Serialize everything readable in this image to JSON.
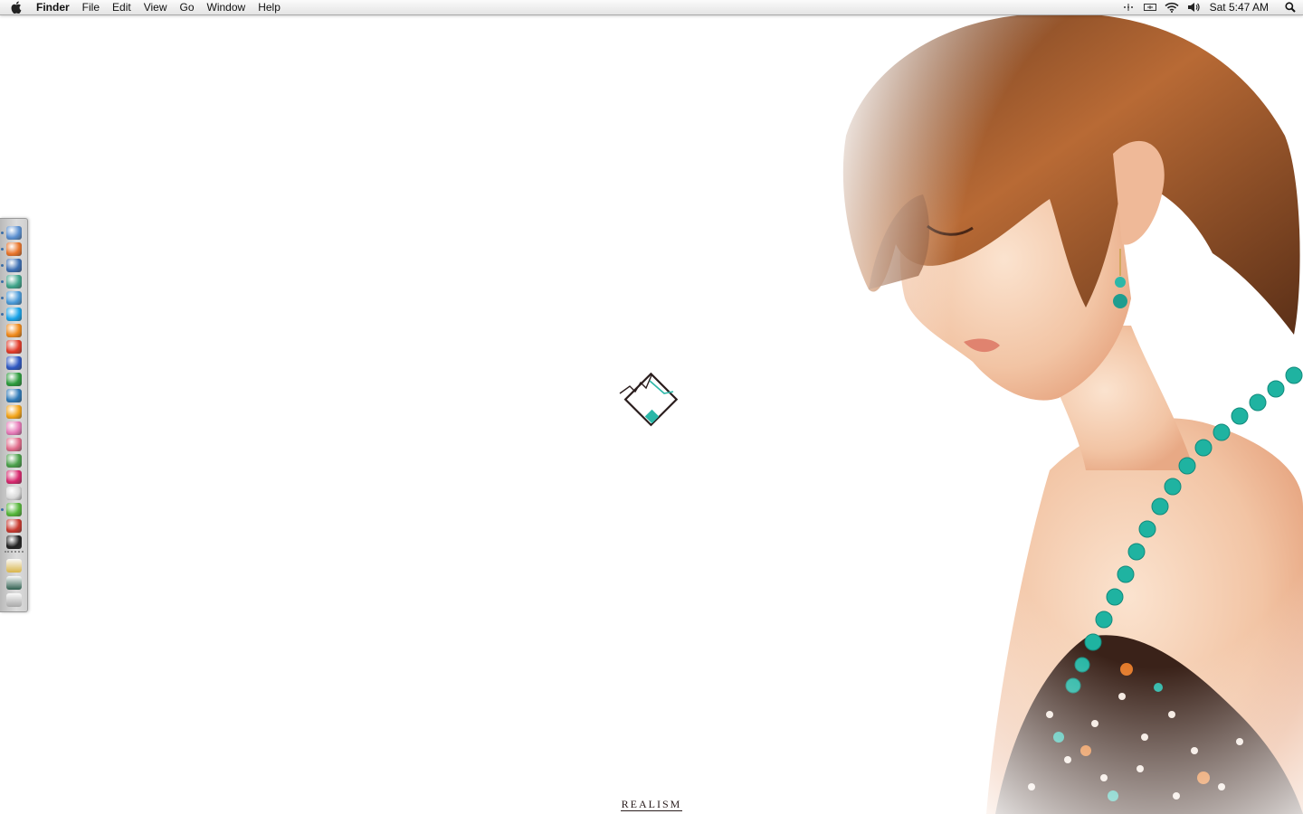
{
  "menubar": {
    "app_name": "Finder",
    "menus": [
      "File",
      "Edit",
      "View",
      "Go",
      "Window",
      "Help"
    ],
    "clock": "Sat 5:47 AM",
    "status_icons": [
      "bluetooth-icon",
      "display-icon",
      "wifi-icon",
      "volume-icon",
      "spotlight-icon"
    ]
  },
  "desktop": {
    "caption": "REALISM"
  },
  "dock": {
    "apps": [
      {
        "icon": "finder-icon",
        "color": "#5a8fd0",
        "running": true
      },
      {
        "icon": "firefox-icon",
        "color": "#e8742a",
        "running": true
      },
      {
        "icon": "mail-bird-icon",
        "color": "#3d6fb3",
        "running": true
      },
      {
        "icon": "adium-icon",
        "color": "#3fa48a",
        "running": true
      },
      {
        "icon": "chat-bubble-icon",
        "color": "#4a9ad8",
        "running": true
      },
      {
        "icon": "skype-icon",
        "color": "#1aa3e8",
        "running": true
      },
      {
        "icon": "vlc-cone-icon",
        "color": "#f08a1c",
        "running": false
      },
      {
        "icon": "tomato-icon",
        "color": "#e23b2a",
        "running": false
      },
      {
        "icon": "blue-cube-icon",
        "color": "#2f58c2",
        "running": false
      },
      {
        "icon": "green-cube-icon",
        "color": "#2c9b3c",
        "running": false
      },
      {
        "icon": "pen-icon",
        "color": "#2f7ab8",
        "running": false
      },
      {
        "icon": "flower-icon",
        "color": "#f3a41a",
        "running": false
      },
      {
        "icon": "butterfly-icon",
        "color": "#e67ab8",
        "running": false
      },
      {
        "icon": "hand-icon",
        "color": "#e06b8a",
        "running": false
      },
      {
        "icon": "leaf-icon",
        "color": "#4aa04a",
        "running": false
      },
      {
        "icon": "pink-flower-icon",
        "color": "#d7286e",
        "running": false
      },
      {
        "icon": "paper-icon",
        "color": "#d8d8d8",
        "running": false
      },
      {
        "icon": "apple-green-icon",
        "color": "#55b63a",
        "running": true
      },
      {
        "icon": "photo-icon",
        "color": "#c8392f",
        "running": false
      },
      {
        "icon": "terminal-icon",
        "color": "#222222",
        "running": false
      }
    ],
    "stacks": [
      {
        "icon": "folder-stack-icon",
        "color": "#d8b54a"
      },
      {
        "icon": "monitor-icon",
        "color": "#2f5f4f"
      },
      {
        "icon": "trash-icon",
        "color": "#a8a8a8"
      }
    ]
  },
  "colors": {
    "accent": "#2cb7a8",
    "logo_stroke": "#2a1d1d"
  }
}
